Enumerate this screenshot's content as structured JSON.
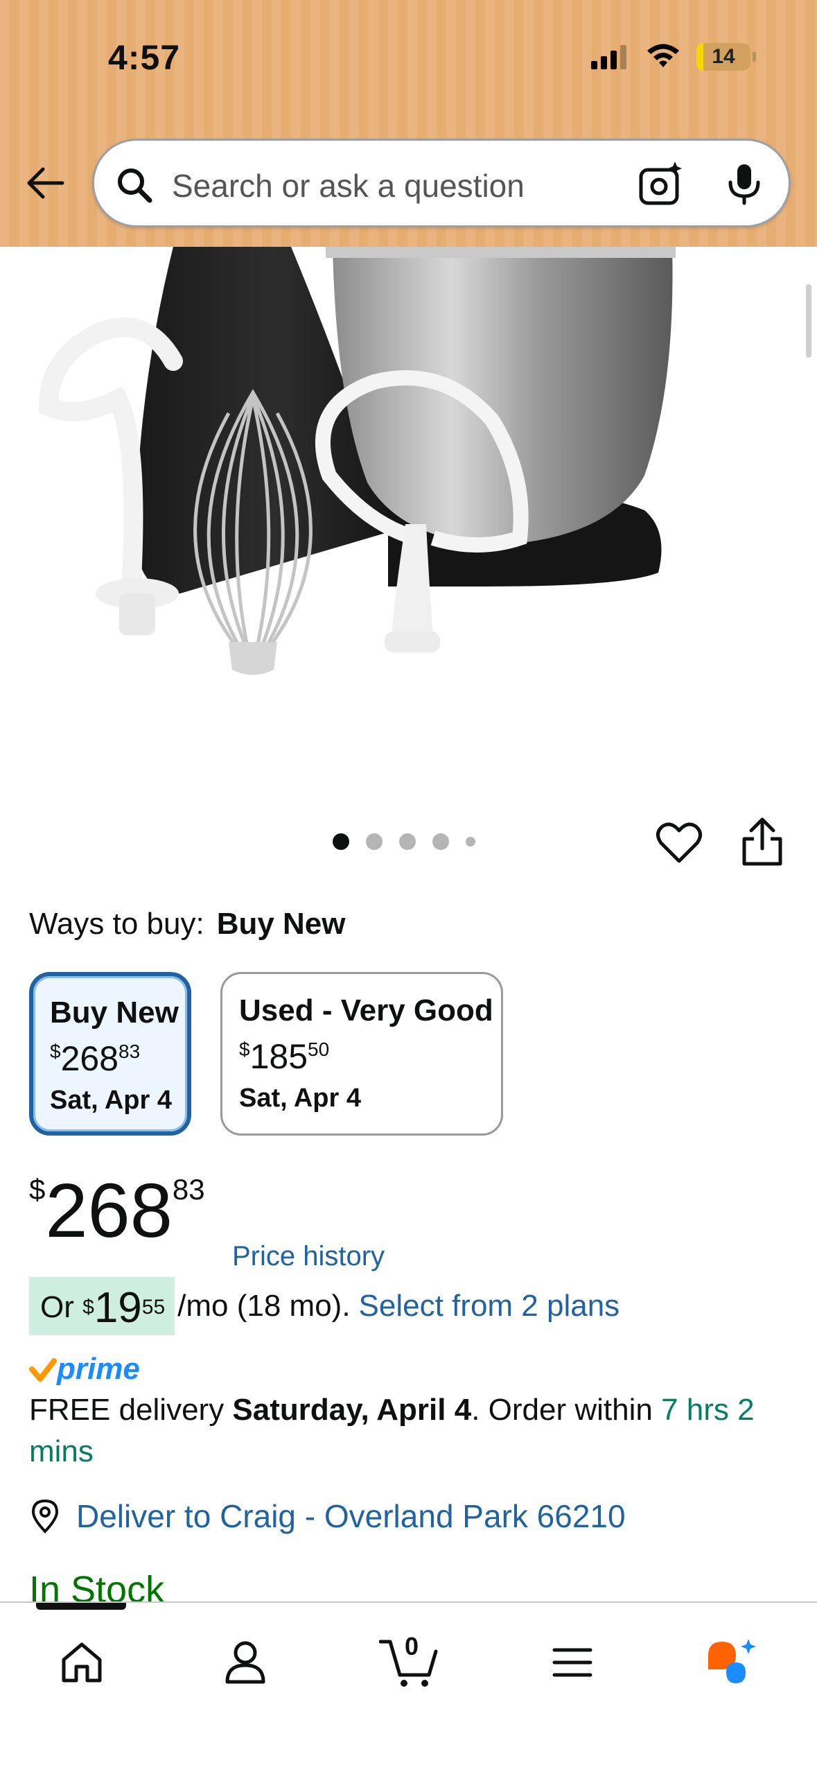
{
  "status_bar": {
    "time": "4:57",
    "battery": "14"
  },
  "search": {
    "placeholder": "Search or ask a question"
  },
  "image_carousel": {
    "count": 5,
    "active_index": 0
  },
  "ways_to_buy": {
    "label": "Ways to buy:",
    "selected": "Buy New",
    "options": [
      {
        "title": "Buy New",
        "currency": "$",
        "dollars": "268",
        "cents": "83",
        "date": "Sat, Apr 4"
      },
      {
        "title": "Used - Very Good",
        "currency": "$",
        "dollars": "185",
        "cents": "50",
        "date": "Sat, Apr 4"
      }
    ]
  },
  "price": {
    "currency": "$",
    "dollars": "268",
    "cents": "83"
  },
  "price_history_label": "Price history",
  "payment_plan": {
    "prefix": "Or",
    "currency": "$",
    "dollars": "19",
    "cents": "55",
    "term": "/mo (18 mo).",
    "link": "Select from 2 plans"
  },
  "prime": {
    "label": "prime"
  },
  "delivery": {
    "prefix": "FREE delivery",
    "date": "Saturday, April 4",
    "middle": ". Order within",
    "countdown": "7 hrs 2 mins"
  },
  "deliver_to": "Deliver to Craig - Overland Park 66210",
  "stock_status": "In Stock",
  "bottom_nav": {
    "cart_count": "0"
  },
  "colors": {
    "header_bg": "#eab47e",
    "link": "#2162a1",
    "green_text": "#067d62",
    "in_stock": "#007600",
    "selected_border": "#2162a1",
    "plan_badge": "#cfeee2",
    "prime_blue": "#1a8cff",
    "prime_check": "#ff9900"
  }
}
